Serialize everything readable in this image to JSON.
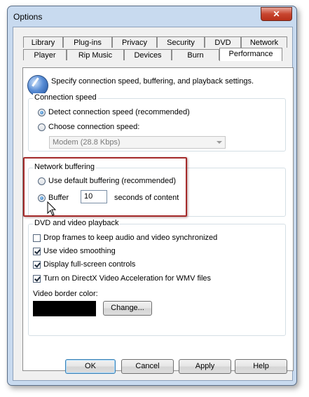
{
  "window": {
    "title": "Options",
    "close_glyph": "✕"
  },
  "tabs": {
    "row_back": [
      "Library",
      "Plug-ins",
      "Privacy",
      "Security",
      "DVD",
      "Network"
    ],
    "row_front": [
      "Player",
      "Rip Music",
      "Devices",
      "Burn",
      "Performance"
    ],
    "active": "Performance"
  },
  "intro": {
    "text": "Specify connection speed, buffering, and playback settings.",
    "icon": "performance-icon"
  },
  "connection": {
    "legend": "Connection speed",
    "detect_label": "Detect connection speed (recommended)",
    "choose_label": "Choose connection speed:",
    "speed_value": "Modem (28.8 Kbps)",
    "detect_checked": true
  },
  "buffering": {
    "legend": "Network buffering",
    "default_label": "Use default buffering (recommended)",
    "buffer_label": "Buffer",
    "buffer_value": "10",
    "seconds_label": "seconds of content",
    "highlight_color": "#a42a2a"
  },
  "dvd": {
    "legend": "DVD and video playback",
    "drop_frames_label": "Drop frames to keep audio and video synchronized",
    "smoothing_label": "Use video smoothing",
    "fullscreen_label": "Display full-screen controls",
    "directx_label": "Turn on DirectX Video Acceleration for WMV files",
    "border_color_label": "Video border color:",
    "border_color": "#000000",
    "change_label": "Change..."
  },
  "buttons": {
    "ok": "OK",
    "cancel": "Cancel",
    "apply": "Apply",
    "help": "Help"
  }
}
